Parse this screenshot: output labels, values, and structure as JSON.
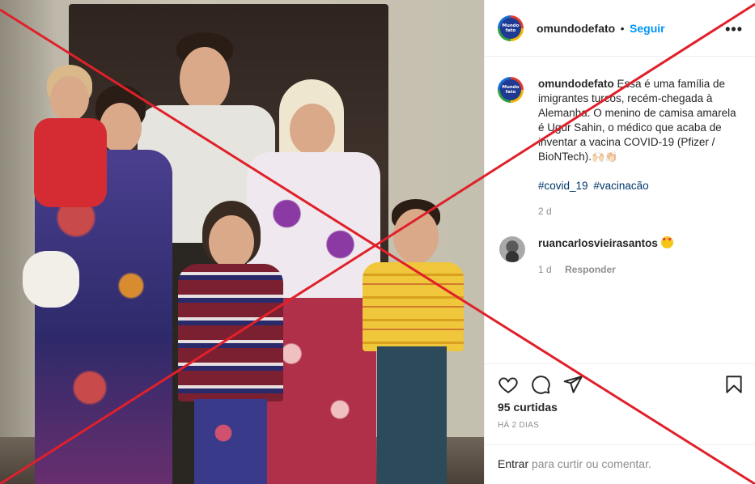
{
  "post": {
    "username": "omundodefato",
    "follow_label": "Seguir",
    "more_label": "•••",
    "avatar_text_top": "Mundo",
    "avatar_text_bottom": "fato"
  },
  "caption": {
    "username": "omundodefato",
    "text": "Essa é uma família de imigrantes turcos, recém-chegada à Alemanha. O menino de camisa amarela é Ugur Sahin, o médico que acaba de inventar a vacina COVID-19 (Pfizer / BioNTech).",
    "emojis": "🙌🏻👏🏻",
    "hashtags": [
      "#covid_19",
      "#vacinacão"
    ],
    "time": "2 d"
  },
  "comments": [
    {
      "username": "ruancarlosvieirasantos",
      "emoji": "heart-eyes-face",
      "time": "1 d",
      "reply_label": "Responder"
    }
  ],
  "actions": {
    "like_icon": "heart-icon",
    "comment_icon": "comment-bubble-icon",
    "share_icon": "paper-plane-icon",
    "save_icon": "bookmark-icon",
    "likes": "95 curtidas",
    "date": "HÁ 2 DIAS"
  },
  "comment_box": {
    "login_label": "Entrar",
    "rest_label": " para curtir ou comentar."
  },
  "colors": {
    "accent": "#0095f6",
    "hashtag": "#00376b",
    "cross": "#e0202a",
    "muted": "#8e8e8e"
  }
}
